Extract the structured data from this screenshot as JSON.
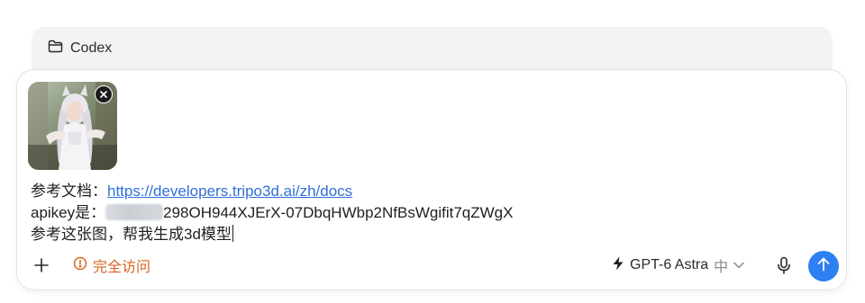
{
  "project": {
    "name": "Codex",
    "icon": "folder-icon"
  },
  "attachment": {
    "icon": "image-thumbnail",
    "remove_icon": "close-icon"
  },
  "message": {
    "line1_prefix": "参考文档：",
    "line1_link": "https://developers.tripo3d.ai/zh/docs",
    "line2_prefix": "apikey是：",
    "line2_value": "298OH944XJErX-07DbqHWbp2NfBsWgifit7qZWgX",
    "line3": "参考这张图，帮我生成3d模型"
  },
  "toolbar": {
    "add_icon": "plus-icon",
    "access_label": "完全访问",
    "access_icon": "alert-circle-icon",
    "model_icon": "lightning-icon",
    "model_name": "GPT-6 Astra",
    "effort_label": "中",
    "dropdown_icon": "chevron-down-icon",
    "mic_icon": "microphone-icon",
    "send_icon": "arrow-up-icon"
  },
  "colors": {
    "accent": "#2d7ff2",
    "link": "#2f6fd6",
    "warning": "#d9631e",
    "project_bar_bg": "#f3f3f3"
  }
}
